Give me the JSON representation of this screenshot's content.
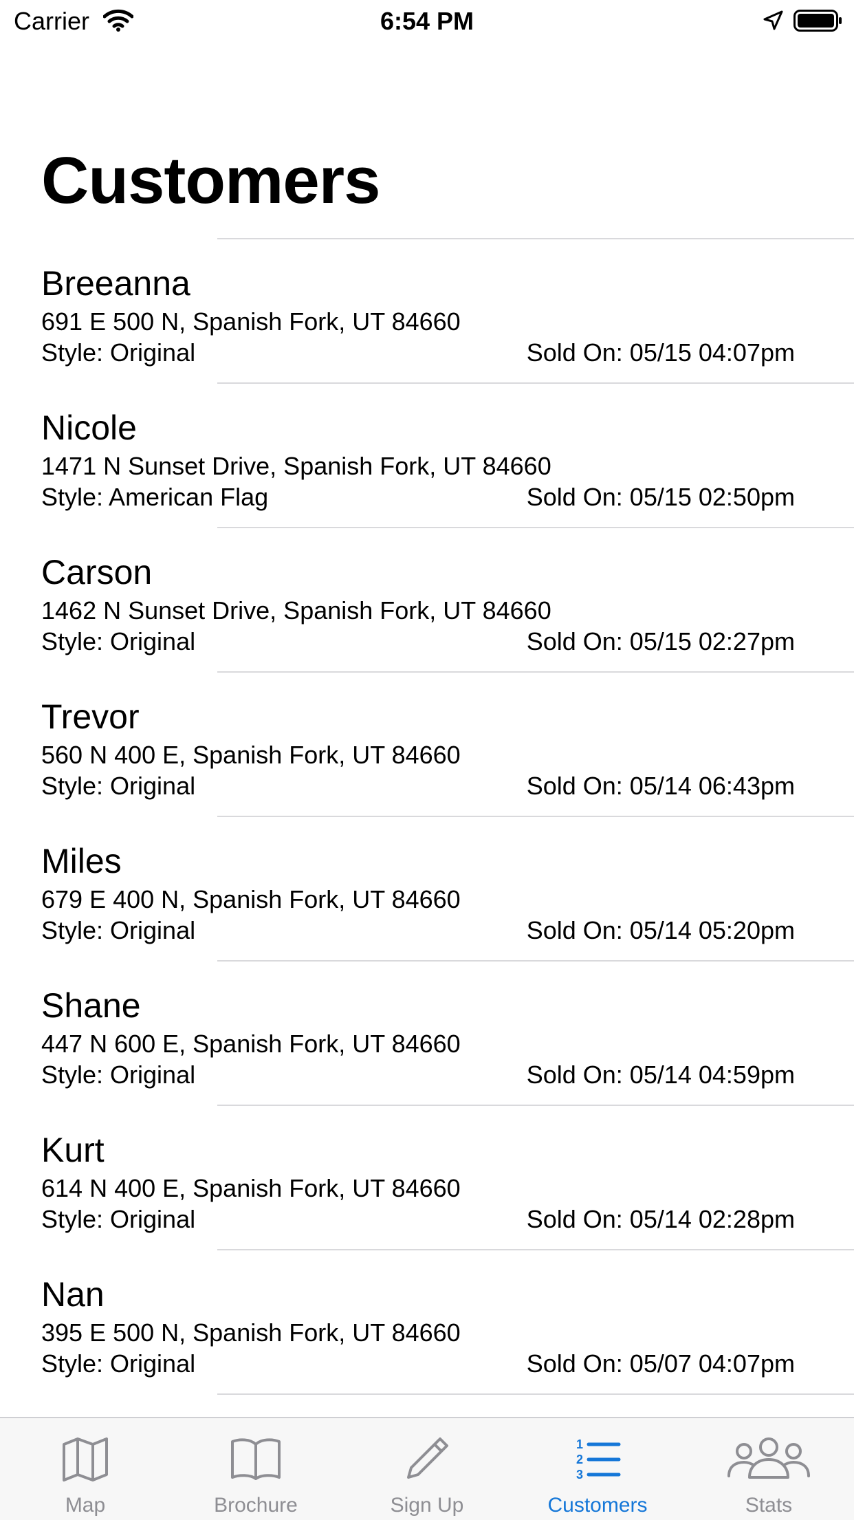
{
  "status_bar": {
    "carrier": "Carrier",
    "time": "6:54 PM"
  },
  "page": {
    "title": "Customers"
  },
  "customers": [
    {
      "name": "Breeanna",
      "address": "691 E 500 N, Spanish Fork, UT 84660",
      "style": "Style: Original",
      "sold_on": "Sold On: 05/15 04:07pm"
    },
    {
      "name": "Nicole",
      "address": "1471 N Sunset Drive, Spanish Fork, UT 84660",
      "style": "Style: American Flag",
      "sold_on": "Sold On: 05/15 02:50pm"
    },
    {
      "name": "Carson",
      "address": "1462 N Sunset Drive, Spanish Fork, UT 84660",
      "style": "Style: Original",
      "sold_on": "Sold On: 05/15 02:27pm"
    },
    {
      "name": "Trevor",
      "address": "560 N 400 E, Spanish Fork, UT 84660",
      "style": "Style: Original",
      "sold_on": "Sold On: 05/14 06:43pm"
    },
    {
      "name": "Miles",
      "address": "679 E 400 N, Spanish Fork, UT 84660",
      "style": "Style: Original",
      "sold_on": "Sold On: 05/14 05:20pm"
    },
    {
      "name": "Shane",
      "address": "447 N 600 E, Spanish Fork, UT 84660",
      "style": "Style: Original",
      "sold_on": "Sold On: 05/14 04:59pm"
    },
    {
      "name": "Kurt",
      "address": "614 N 400 E, Spanish Fork, UT 84660",
      "style": "Style: Original",
      "sold_on": "Sold On: 05/14 02:28pm"
    },
    {
      "name": "Nan",
      "address": "395 E 500 N, Spanish Fork, UT 84660",
      "style": "Style: Original",
      "sold_on": "Sold On: 05/07 04:07pm"
    }
  ],
  "tab_bar": {
    "active_color": "#1577d8",
    "inactive_color": "#8e8e93",
    "tabs": [
      {
        "label": "Map",
        "icon": "map-icon",
        "active": false
      },
      {
        "label": "Brochure",
        "icon": "book-icon",
        "active": false
      },
      {
        "label": "Sign Up",
        "icon": "pencil-icon",
        "active": false
      },
      {
        "label": "Customers",
        "icon": "numbered-list-icon",
        "active": true
      },
      {
        "label": "Stats",
        "icon": "people-icon",
        "active": false
      }
    ]
  }
}
